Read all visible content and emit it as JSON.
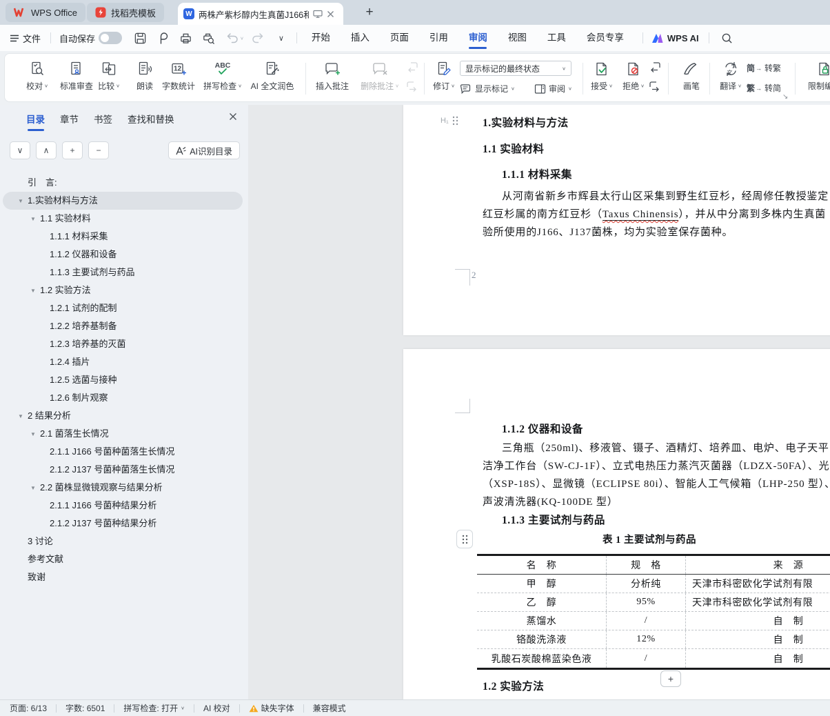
{
  "icons": {
    "caret": "∨",
    "chevron_down": "∨",
    "chevron_up": "∧",
    "plus": "+",
    "minus": "−",
    "close": "✕",
    "add_tab": "+",
    "triangle_down": "▼",
    "expand_corner": "↘"
  },
  "tabbar": {
    "app": "WPS Office",
    "docer": "找稻壳模板",
    "doc_title": "两株产紫杉醇内生真菌J166和"
  },
  "menubar": {
    "file": "文件",
    "autosave": "自动保存",
    "tabs": [
      {
        "label": "开始",
        "active": false
      },
      {
        "label": "插入",
        "active": false
      },
      {
        "label": "页面",
        "active": false
      },
      {
        "label": "引用",
        "active": false
      },
      {
        "label": "审阅",
        "active": true
      },
      {
        "label": "视图",
        "active": false
      },
      {
        "label": "工具",
        "active": false
      },
      {
        "label": "会员专享",
        "active": false
      }
    ],
    "wps_ai": "WPS AI"
  },
  "ribbon": {
    "proofread": "校对",
    "standard_review": "标准审查",
    "compare": "比较",
    "read_aloud": "朗读",
    "word_count": "字数统计",
    "word_count_icon_text": "12",
    "spell_check": "拼写检查",
    "spell_icon_text": "ABC",
    "ai_polish": "AI 全文润色",
    "insert_comment": "插入批注",
    "delete_comment": "删除批注",
    "revise": "修订",
    "markup_final_state": "显示标记的最终状态",
    "show_markup": "显示标记",
    "review_pane": "审阅",
    "accept": "接受",
    "reject": "拒绝",
    "pen": "画笔",
    "translate": "翻译",
    "s2t_char": "简",
    "s2t_label": "转繁",
    "t2s_char": "繁",
    "t2s_label": "转简",
    "restrict_edit": "限制编辑"
  },
  "sidebar": {
    "tabs": [
      {
        "label": "目录",
        "active": true
      },
      {
        "label": "章节",
        "active": false
      },
      {
        "label": "书签",
        "active": false
      },
      {
        "label": "查找和替换",
        "active": false
      }
    ],
    "ai_recognize": "AI识别目录",
    "toc": [
      {
        "label": "引　言:",
        "level": 0,
        "arrow": false,
        "selected": false
      },
      {
        "label": "1.实验材料与方法",
        "level": 0,
        "arrow": true,
        "selected": true
      },
      {
        "label": "1.1 实验材料",
        "level": 1,
        "arrow": true,
        "selected": false
      },
      {
        "label": "1.1.1 材料采集",
        "level": 2,
        "arrow": false,
        "selected": false
      },
      {
        "label": "1.1.2 仪器和设备",
        "level": 2,
        "arrow": false,
        "selected": false
      },
      {
        "label": "1.1.3 主要试剂与药品",
        "level": 2,
        "arrow": false,
        "selected": false
      },
      {
        "label": "1.2 实验方法",
        "level": 1,
        "arrow": true,
        "selected": false
      },
      {
        "label": "1.2.1 试剂的配制",
        "level": 2,
        "arrow": false,
        "selected": false
      },
      {
        "label": "1.2.2 培养基制备",
        "level": 2,
        "arrow": false,
        "selected": false
      },
      {
        "label": "1.2.3 培养基的灭菌",
        "level": 2,
        "arrow": false,
        "selected": false
      },
      {
        "label": "1.2.4 插片",
        "level": 2,
        "arrow": false,
        "selected": false
      },
      {
        "label": "1.2.5 选菌与接种",
        "level": 2,
        "arrow": false,
        "selected": false
      },
      {
        "label": "1.2.6 制片观察",
        "level": 2,
        "arrow": false,
        "selected": false
      },
      {
        "label": "2 结果分析",
        "level": 0,
        "arrow": true,
        "selected": false
      },
      {
        "label": "2.1 菌落生长情况",
        "level": 1,
        "arrow": true,
        "selected": false
      },
      {
        "label": "2.1.1 J166 号菌种菌落生长情况",
        "level": 2,
        "arrow": false,
        "selected": false
      },
      {
        "label": "2.1.2 J137 号菌种菌落生长情况",
        "level": 2,
        "arrow": false,
        "selected": false
      },
      {
        "label": "2.2 菌株显微镜观察与结果分析",
        "level": 1,
        "arrow": true,
        "selected": false
      },
      {
        "label": "2.1.1 J166 号菌种结果分析",
        "level": 2,
        "arrow": false,
        "selected": false
      },
      {
        "label": "2.1.2 J137 号菌种结果分析",
        "level": 2,
        "arrow": false,
        "selected": false
      },
      {
        "label": "3 讨论",
        "level": 0,
        "arrow": false,
        "selected": false
      },
      {
        "label": "参考文献",
        "level": 0,
        "arrow": false,
        "selected": false
      },
      {
        "label": "致谢",
        "level": 0,
        "arrow": false,
        "selected": false
      }
    ]
  },
  "document": {
    "page1": {
      "heading_marker": "H₁",
      "h1": "1.实验材料与方法",
      "h2": "1.1  实验材料",
      "h3": "1.1.1  材料采集",
      "para_line1": "从河南省新乡市辉县太行山区采集到野生红豆杉，经周修任教授鉴定",
      "para_line2_pre": "红豆杉属的南方红豆杉（",
      "para_line2_latin": "Taxus Chinensis",
      "para_line2_post": "），并从中分离到多株内生真菌",
      "para_line3": "验所使用的J166、J137菌株，均为实验室保存菌种。",
      "page_number": "2"
    },
    "page2": {
      "h3a": "1.1.2  仪器和设备",
      "para_line1": "三角瓶（250ml)、移液管、镊子、酒精灯、培养皿、电炉、电子天平（TB",
      "para_line2": "洁净工作台（SW-CJ-1F）、立式电热压力蒸汽灭菌器（LDZX-50FA）、光学",
      "para_line3": "（XSP-18S）、显微镜（ECLIPSE 80i）、智能人工气候箱（LHP-250 型）、",
      "para_line4": "声波清洗器(KQ-100DE 型）",
      "h3b": "1.1.3  主要试剂与药品",
      "table_caption": "表 1  主要试剂与药品",
      "table": {
        "headers": [
          "名　称",
          "规　格",
          "来　源"
        ],
        "rows": [
          [
            "甲　醇",
            "分析纯",
            "天津市科密欧化学试剂有限"
          ],
          [
            "乙　醇",
            "95%",
            "天津市科密欧化学试剂有限"
          ],
          [
            "蒸馏水",
            "/",
            "自　制"
          ],
          [
            "铬酸洗涤液",
            "12%",
            "自　制"
          ],
          [
            "乳酸石炭酸棉蓝染色液",
            "/",
            "自　制"
          ]
        ]
      },
      "h2b": "1.2  实验方法"
    }
  },
  "statusbar": {
    "page": "页面: 6/13",
    "words": "字数: 6501",
    "spell": "拼写检查: 打开",
    "ai_proof": "AI 校对",
    "missing_font": "缺失字体",
    "compat": "兼容模式"
  }
}
